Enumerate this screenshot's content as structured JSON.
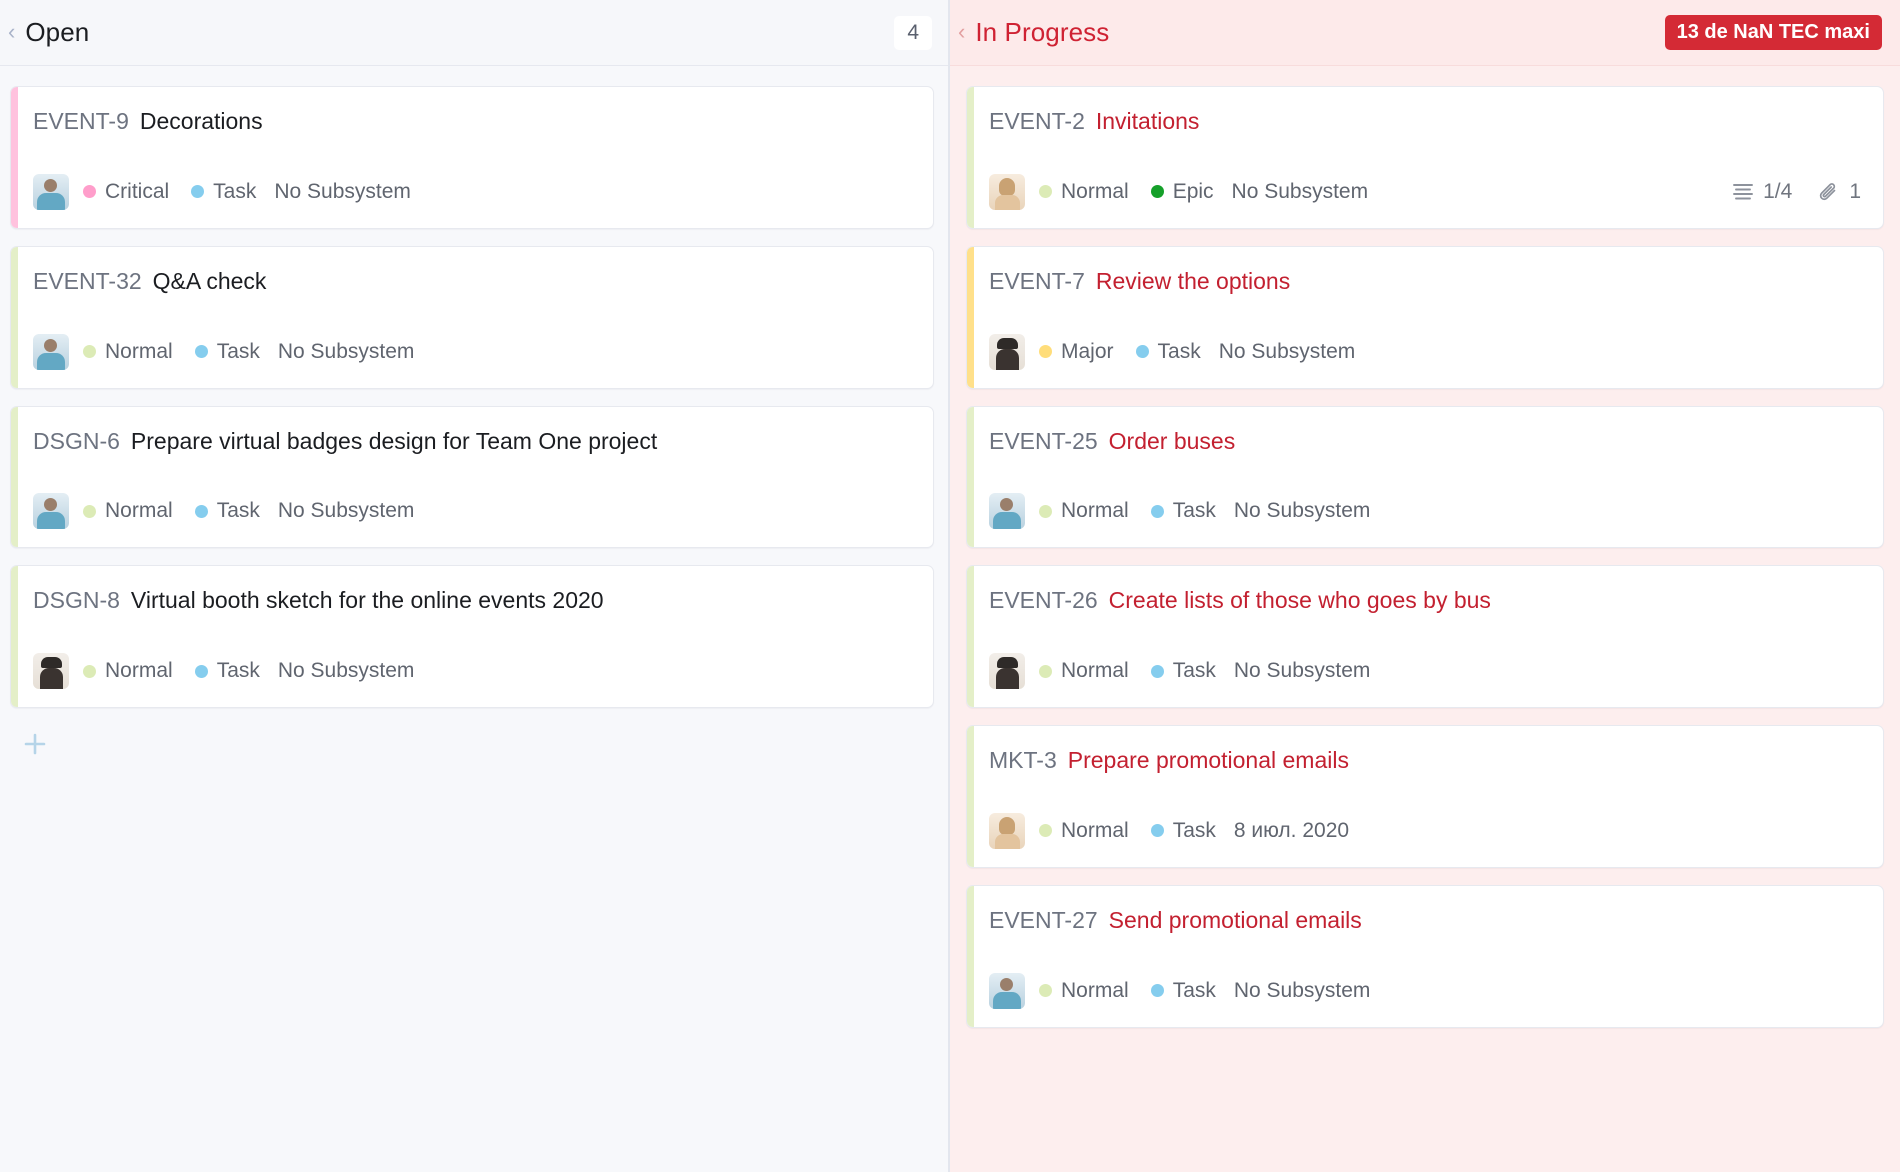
{
  "columns": [
    {
      "key": "open",
      "title": "Open",
      "collapse_icon": "chevron-left-icon",
      "count": "4",
      "add_icon": "plus-icon",
      "cards": [
        {
          "id": "EVENT-9",
          "title": "Decorations",
          "stripe_color": "#ffc2de",
          "avatar": "av-blue",
          "priority": "Critical",
          "priority_color": "#ff9ecb",
          "type": "Task",
          "type_color": "#85cdee",
          "subsystem": "No Subsystem"
        },
        {
          "id": "EVENT-32",
          "title": "Q&A check",
          "stripe_color": "#e4efc8",
          "avatar": "av-blue",
          "priority": "Normal",
          "priority_color": "#dcebb6",
          "type": "Task",
          "type_color": "#85cdee",
          "subsystem": "No Subsystem"
        },
        {
          "id": "DSGN-6",
          "title": "Prepare virtual badges design for Team One project",
          "stripe_color": "#e4efc8",
          "avatar": "av-blue",
          "priority": "Normal",
          "priority_color": "#dcebb6",
          "type": "Task",
          "type_color": "#85cdee",
          "subsystem": "No Subsystem"
        },
        {
          "id": "DSGN-8",
          "title": "Virtual booth sketch for the online events 2020",
          "stripe_color": "#e4efc8",
          "avatar": "av-dark",
          "priority": "Normal",
          "priority_color": "#dcebb6",
          "type": "Task",
          "type_color": "#85cdee",
          "subsystem": "No Subsystem"
        }
      ]
    },
    {
      "key": "in-progress",
      "title": "In Progress",
      "collapse_icon": "chevron-left-icon",
      "wip_badge": "13 de NaN TEC maxi",
      "wip_badge_color": "#d42a35",
      "cards": [
        {
          "id": "EVENT-2",
          "title": "Invitations",
          "stripe_color": "#e4efc8",
          "avatar": "av-blonde",
          "priority": "Normal",
          "priority_color": "#dcebb6",
          "type": "Epic",
          "type_color": "#15a02a",
          "subsystem": "No Subsystem",
          "checklist": "1/4",
          "checklist_icon": "checklist-icon",
          "attachments": "1",
          "attachments_icon": "paperclip-icon"
        },
        {
          "id": "EVENT-7",
          "title": "Review the options",
          "stripe_color": "#ffe08a",
          "avatar": "av-dark",
          "priority": "Major",
          "priority_color": "#ffdd7a",
          "type": "Task",
          "type_color": "#85cdee",
          "subsystem": "No Subsystem"
        },
        {
          "id": "EVENT-25",
          "title": "Order buses",
          "stripe_color": "#e4efc8",
          "avatar": "av-blue",
          "priority": "Normal",
          "priority_color": "#dcebb6",
          "type": "Task",
          "type_color": "#85cdee",
          "subsystem": "No Subsystem"
        },
        {
          "id": "EVENT-26",
          "title": "Create lists of those who goes by bus",
          "stripe_color": "#e4efc8",
          "avatar": "av-dark",
          "priority": "Normal",
          "priority_color": "#dcebb6",
          "type": "Task",
          "type_color": "#85cdee",
          "subsystem": "No Subsystem"
        },
        {
          "id": "MKT-3",
          "title": "Prepare promotional emails",
          "stripe_color": "#e4efc8",
          "avatar": "av-blonde",
          "priority": "Normal",
          "priority_color": "#dcebb6",
          "type": "Task",
          "type_color": "#85cdee",
          "subsystem": "8 июл. 2020"
        },
        {
          "id": "EVENT-27",
          "title": "Send promotional emails",
          "stripe_color": "#e4efc8",
          "avatar": "av-blue",
          "priority": "Normal",
          "priority_color": "#dcebb6",
          "type": "Task",
          "type_color": "#85cdee",
          "subsystem": "No Subsystem"
        }
      ]
    }
  ]
}
